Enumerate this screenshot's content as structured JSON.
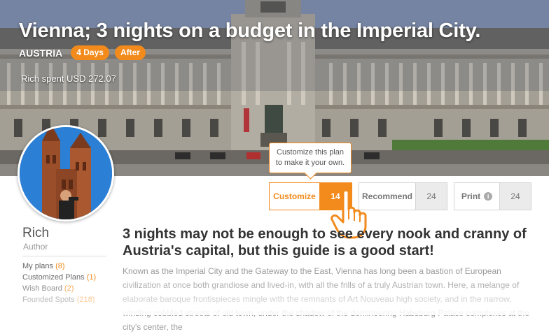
{
  "hero": {
    "title": "Vienna; 3 nights on a budget in the Imperial City.",
    "country": "AUSTRIA",
    "tags": [
      "4 Days",
      "After"
    ],
    "spent": "Rich spent USD 272.07"
  },
  "tooltip": {
    "line1": "Customize this plan",
    "line2": "to make it your own."
  },
  "actions": {
    "customize": {
      "label": "Customize",
      "count": "14"
    },
    "recommend": {
      "label": "Recommend",
      "count": "24"
    },
    "print": {
      "label": "Print",
      "count": "24"
    }
  },
  "author": {
    "name": "Rich",
    "role": "Author",
    "stats": [
      {
        "label": "My plans",
        "count": "(8)"
      },
      {
        "label": "Customized Plans",
        "count": "(1)"
      },
      {
        "label": "Wish Board",
        "count": "(2)"
      },
      {
        "label": "Founded Spots",
        "count": "(218)"
      }
    ]
  },
  "content": {
    "headline": "3 nights may not be enough to see every nook and cranny of Austria's capital, but this guide is a good start!",
    "body": "Known as the Imperial City and the Gateway to the East, Vienna has long been a bastion of European civilization at once both grandiose and lived-in, with all the frills of a truly Austrian town. Here, a melange of elaborate baroque frontispieces mingle with the remnants of Art Nouveau high society, and in the narrow, winding cobbled streets of old town, under the shadow of the domineering Habsburg Palace complexes at the city's center, the"
  },
  "colors": {
    "accent": "#f28a1c",
    "text": "#333333",
    "muted": "#9a9a9a"
  },
  "icons": [
    "info-icon",
    "pointing-hand-icon"
  ]
}
